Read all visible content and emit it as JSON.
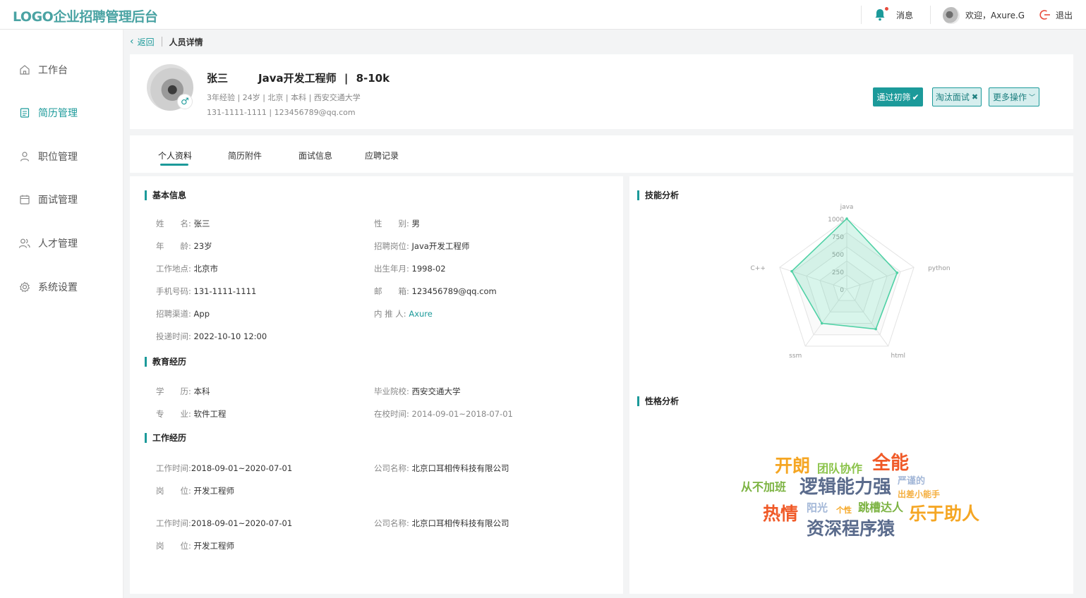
{
  "header": {
    "logo": "LOGO企业招聘管理后台",
    "messages": "消息",
    "welcome": "欢迎，Axure.G",
    "logout": "退出"
  },
  "sidebar": {
    "items": [
      {
        "label": "工作台",
        "icon": "home-icon"
      },
      {
        "label": "简历管理",
        "icon": "resume-icon",
        "active": true
      },
      {
        "label": "职位管理",
        "icon": "person-icon"
      },
      {
        "label": "面试管理",
        "icon": "calendar-icon"
      },
      {
        "label": "人才管理",
        "icon": "people-icon"
      },
      {
        "label": "系统设置",
        "icon": "gear-icon"
      }
    ]
  },
  "breadcrumb": {
    "back": "返回",
    "current": "人员详情"
  },
  "profile": {
    "name": "张三",
    "position": "Java开发工程师",
    "divider": "|",
    "salary": "8-10k",
    "meta": "3年经验 | 24岁 | 北京 | 本科 | 西安交通大学",
    "contact": "131-1111-1111 | 123456789@qq.com",
    "gender_symbol": "♂"
  },
  "actions": {
    "pass": "通过初筛",
    "reject": "淘汰面试",
    "more": "更多操作"
  },
  "tabs": [
    "个人资料",
    "简历附件",
    "面试信息",
    "应聘记录"
  ],
  "basic": {
    "title": "基本信息",
    "name_label": "姓　　名:",
    "name": "张三",
    "gender_label": "性　　别:",
    "gender": "男",
    "age_label": "年　　龄:",
    "age": "23岁",
    "job_label": "招聘岗位:",
    "job": "Java开发工程师",
    "location_label": "工作地点:",
    "location": "北京市",
    "birth_label": "出生年月:",
    "birth": "1998-02",
    "phone_label": "手机号码:",
    "phone": "131-1111-1111",
    "email_label": "邮　　箱:",
    "email": "123456789@qq.com",
    "channel_label": "招聘渠道:",
    "channel": "App",
    "referrer_label": "内 推 人:",
    "referrer": "Axure",
    "submit_label": "投递时间:",
    "submit": "2022-10-10 12:00"
  },
  "education": {
    "title": "教育经历",
    "degree_label": "学　　历:",
    "degree": "本科",
    "school_label": "毕业院校:",
    "school": "西安交通大学",
    "major_label": "专　　业:",
    "major": "软件工程",
    "period_label": "在校时间:",
    "period": "2014-09-01~2018-07-01"
  },
  "work": {
    "title": "工作经历",
    "entries": [
      {
        "time_label": "工作时间:",
        "time": "2018-09-01~2020-07-01",
        "company_label": "公司名称:",
        "company": "北京口耳相传科技有限公司",
        "post_label": "岗　　位:",
        "post": "开发工程师"
      },
      {
        "time_label": "工作时间:",
        "time": "2018-09-01~2020-07-01",
        "company_label": "公司名称:",
        "company": "北京口耳相传科技有限公司",
        "post_label": "岗　　位:",
        "post": "开发工程师"
      }
    ]
  },
  "skills": {
    "title": "技能分析"
  },
  "personality": {
    "title": "性格分析",
    "words": [
      {
        "text": "开朗",
        "color": "#f5a623"
      },
      {
        "text": "团队协作",
        "color": "#8bc34a"
      },
      {
        "text": "全能",
        "color": "#f05a28"
      },
      {
        "text": "严谨的",
        "color": "#a4b8d8"
      },
      {
        "text": "从不加班",
        "color": "#7cb342"
      },
      {
        "text": "逻辑能力强",
        "color": "#5a6b8c"
      },
      {
        "text": "出差小能手",
        "color": "#f5b041"
      },
      {
        "text": "热情",
        "color": "#f05a28"
      },
      {
        "text": "阳光",
        "color": "#a4b8d8"
      },
      {
        "text": "个性",
        "color": "#f5a623"
      },
      {
        "text": "跳槽达人",
        "color": "#7cb342"
      },
      {
        "text": "乐于助人",
        "color": "#f5a623"
      },
      {
        "text": "资深程序猿",
        "color": "#5a6b8c"
      }
    ]
  },
  "chart_data": {
    "type": "radar",
    "indicators": [
      "java",
      "python",
      "html",
      "ssm",
      "C++"
    ],
    "ticks": [
      "0",
      "250",
      "500",
      "750",
      "1000"
    ],
    "max": 1000,
    "values": [
      1000,
      750,
      700,
      600,
      820
    ],
    "color": "#4fd1a5"
  },
  "colors": {
    "accent": "#1c9a9a",
    "logo": "#4aa3a3"
  }
}
